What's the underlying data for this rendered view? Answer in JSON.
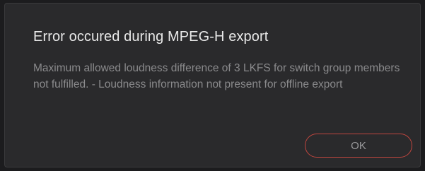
{
  "dialog": {
    "title": "Error occured during MPEG-H export",
    "message": "Maximum allowed loudness difference of 3 LKFS for switch group members not fulfilled. - Loudness information not present for offline export",
    "ok_label": "OK"
  },
  "colors": {
    "background": "#2a2a2c",
    "title": "#e8e8e8",
    "message": "#8a8a8c",
    "ok_border": "#c0463f"
  }
}
